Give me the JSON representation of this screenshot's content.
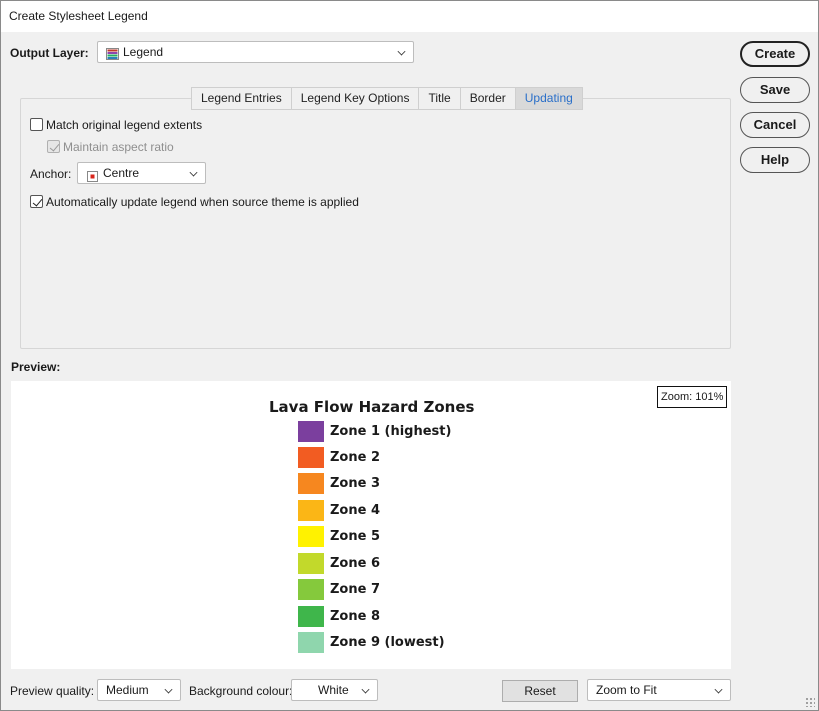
{
  "window": {
    "title": "Create Stylesheet Legend"
  },
  "output_layer": {
    "label": "Output Layer:",
    "value": "Legend",
    "icon": "legend-layer-icon"
  },
  "buttons": {
    "create": "Create",
    "save": "Save",
    "cancel": "Cancel",
    "help": "Help"
  },
  "tabs": [
    {
      "label": "Legend Entries",
      "active": false
    },
    {
      "label": "Legend Key Options",
      "active": false
    },
    {
      "label": "Title",
      "active": false
    },
    {
      "label": "Border",
      "active": false
    },
    {
      "label": "Updating",
      "active": true
    }
  ],
  "updating": {
    "match_extents": {
      "label": "Match original legend extents",
      "checked": false
    },
    "maintain_aspect": {
      "label": "Maintain aspect ratio",
      "checked": true,
      "enabled": false
    },
    "anchor": {
      "label": "Anchor:",
      "value": "Centre",
      "icon": "anchor-point-icon"
    },
    "auto_update": {
      "label": "Automatically update legend when source theme is applied",
      "checked": true
    }
  },
  "preview": {
    "label": "Preview:",
    "zoom": "Zoom: 101%",
    "legend_title": "Lava Flow Hazard Zones",
    "entries": [
      {
        "label": "Zone 1 (highest)",
        "color": "#7b3f9e"
      },
      {
        "label": "Zone 2",
        "color": "#f25c22"
      },
      {
        "label": "Zone 3",
        "color": "#f6871f"
      },
      {
        "label": "Zone 4",
        "color": "#fbb616"
      },
      {
        "label": "Zone 5",
        "color": "#fff200"
      },
      {
        "label": "Zone 6",
        "color": "#c2d92b"
      },
      {
        "label": "Zone 7",
        "color": "#85c93c"
      },
      {
        "label": "Zone 8",
        "color": "#3fb64b"
      },
      {
        "label": "Zone 9 (lowest)",
        "color": "#8fd6ad"
      }
    ]
  },
  "footer": {
    "quality_label": "Preview quality:",
    "quality_value": "Medium",
    "background_label": "Background colour:",
    "background_value": "White",
    "reset": "Reset",
    "zoom_mode": "Zoom to Fit"
  }
}
